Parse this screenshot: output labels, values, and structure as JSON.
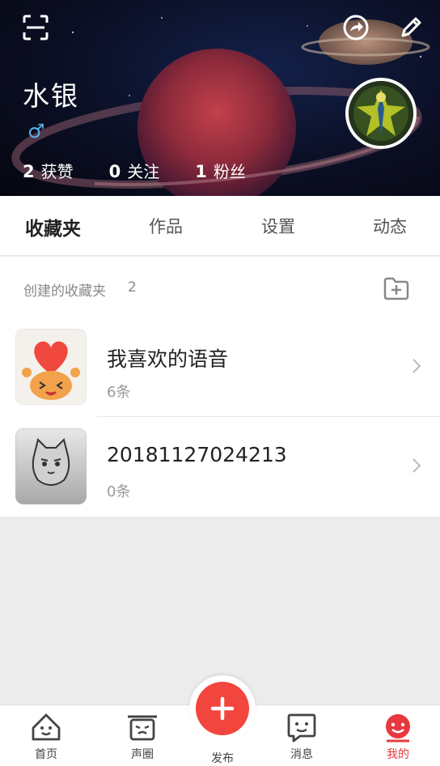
{
  "header": {
    "username": "水银",
    "gender_symbol": "♂",
    "stats": [
      {
        "num": "2",
        "label": "获赞"
      },
      {
        "num": "0",
        "label": "关注"
      },
      {
        "num": "1",
        "label": "粉丝"
      }
    ],
    "icons": [
      "scan-icon",
      "share-icon",
      "edit-icon"
    ]
  },
  "tabs": [
    {
      "label": "收藏夹",
      "active": true
    },
    {
      "label": "作品"
    },
    {
      "label": "设置"
    },
    {
      "label": "动态"
    }
  ],
  "favorites": {
    "title": "创建的收藏夹",
    "count": "2",
    "items": [
      {
        "title": "我喜欢的语音",
        "sub": "6条"
      },
      {
        "title": "20181127024213",
        "sub": "0条"
      }
    ]
  },
  "bottom_nav": {
    "items": [
      {
        "label": "首页"
      },
      {
        "label": "声圈"
      },
      {
        "label": "发布"
      },
      {
        "label": "消息"
      },
      {
        "label": "我的"
      }
    ],
    "active_color": "#e8383d"
  },
  "colors": {
    "accent": "#f2453d",
    "gender": "#5aaee8"
  }
}
